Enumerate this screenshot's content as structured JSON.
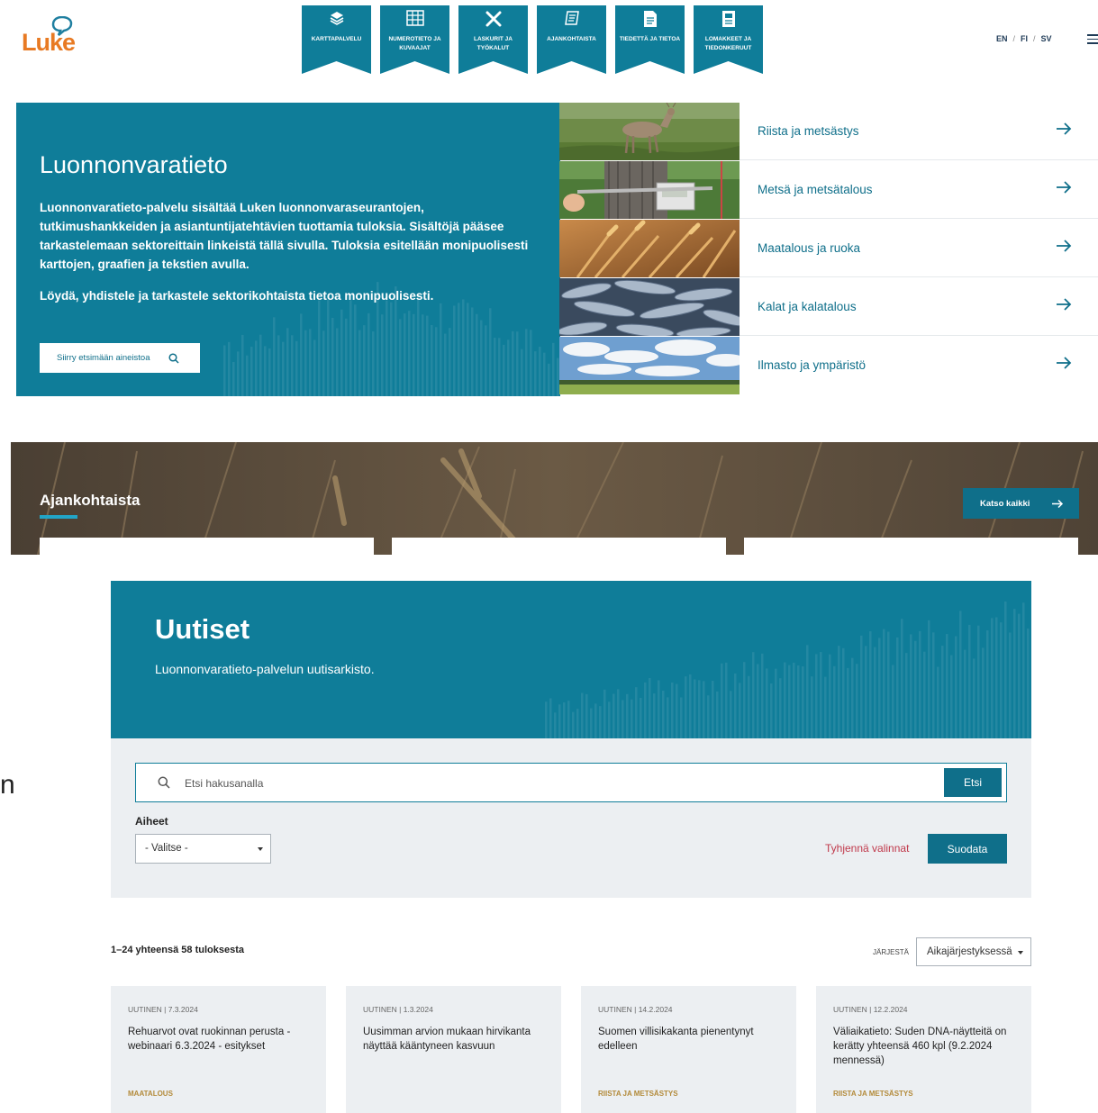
{
  "header": {
    "logo_text": "Luke",
    "nav": [
      {
        "label": "KARTTAPALVELU",
        "icon": "layers-icon"
      },
      {
        "label": "NUMEROTIETO JA KUVAAJAT",
        "icon": "table-icon"
      },
      {
        "label": "LASKURIT JA TYÖKALUT",
        "icon": "tools-icon"
      },
      {
        "label": "AJANKOHTAISTA",
        "icon": "document-icon"
      },
      {
        "label": "TIEDETTÄ JA TIETOA",
        "icon": "file-icon"
      },
      {
        "label": "LOMAKKEET JA TIEDONKERUUT",
        "icon": "form-icon"
      }
    ],
    "langs": [
      "EN",
      "FI",
      "SV"
    ],
    "lang_sep": "/"
  },
  "hero": {
    "title": "Luonnonvaratieto",
    "text": "Luonnonvaratieto-palvelu sisältää Luken luonnonvaraseurantojen, tutkimushankkeiden ja asiantuntijatehtävien tuottamia tuloksia. Sisältöjä pääsee tarkastelemaan sektoreittain linkeistä tällä sivulla. Tuloksia esitellään monipuolisesti karttojen, graafien ja tekstien avulla.",
    "text2": "Löydä, yhdistele ja tarkastele sektorikohtaista tietoa monipuolisesti.",
    "button": "Siirry etsimään aineistoa"
  },
  "sectors": [
    {
      "label": "Riista ja metsästys",
      "image": "deer-photo"
    },
    {
      "label": "Metsä ja metsätalous",
      "image": "forest-measurement-photo"
    },
    {
      "label": "Maatalous ja ruoka",
      "image": "wheat-photo"
    },
    {
      "label": "Kalat ja kalatalous",
      "image": "fish-photo"
    },
    {
      "label": "Ilmasto ja ympäristö",
      "image": "sky-landscape-photo"
    }
  ],
  "band": {
    "title": "Ajankohtaista",
    "button": "Katso kaikki"
  },
  "news": {
    "title": "Uutiset",
    "subtitle": "Luonnonvaratieto-palvelun uutisarkisto.",
    "search_placeholder": "Etsi hakusanalla",
    "search_button": "Etsi",
    "topics_label": "Aiheet",
    "topics_selected": "- Valitse -",
    "clear": "Tyhjennä valinnat",
    "filter_button": "Suodata",
    "results": "1–24 yhteensä 58 tuloksesta",
    "sort_label": "JÄRJESTÄ",
    "sort_selected": "Aikajärjestyksessä",
    "cards": [
      {
        "meta": "UUTINEN | 7.3.2024",
        "title": "Rehuarvot ovat ruokinnan perusta - webinaari 6.3.2024 - esitykset",
        "tag": "MAATALOUS"
      },
      {
        "meta": "UUTINEN | 1.3.2024",
        "title": "Uusimman arvion mukaan hirvikanta näyttää kääntyneen kasvuun",
        "tag": ""
      },
      {
        "meta": "UUTINEN | 14.2.2024",
        "title": "Suomen villisikakanta pienentynyt edelleen",
        "tag": "RIISTA JA METSÄSTYS"
      },
      {
        "meta": "UUTINEN | 12.2.2024",
        "title": "Väliaikatieto: Suden DNA-näytteitä on kerätty yhteensä 460 kpl (9.2.2024 mennessä)",
        "tag": "RIISTA JA METSÄSTYS"
      }
    ]
  },
  "stray_glyph": "n",
  "colors": {
    "brand_teal": "#0f7d99",
    "button_teal": "#0f6f8a",
    "logo_orange": "#e87a23",
    "clear_red": "#c0394b",
    "tag_gold": "#b38a3a"
  }
}
